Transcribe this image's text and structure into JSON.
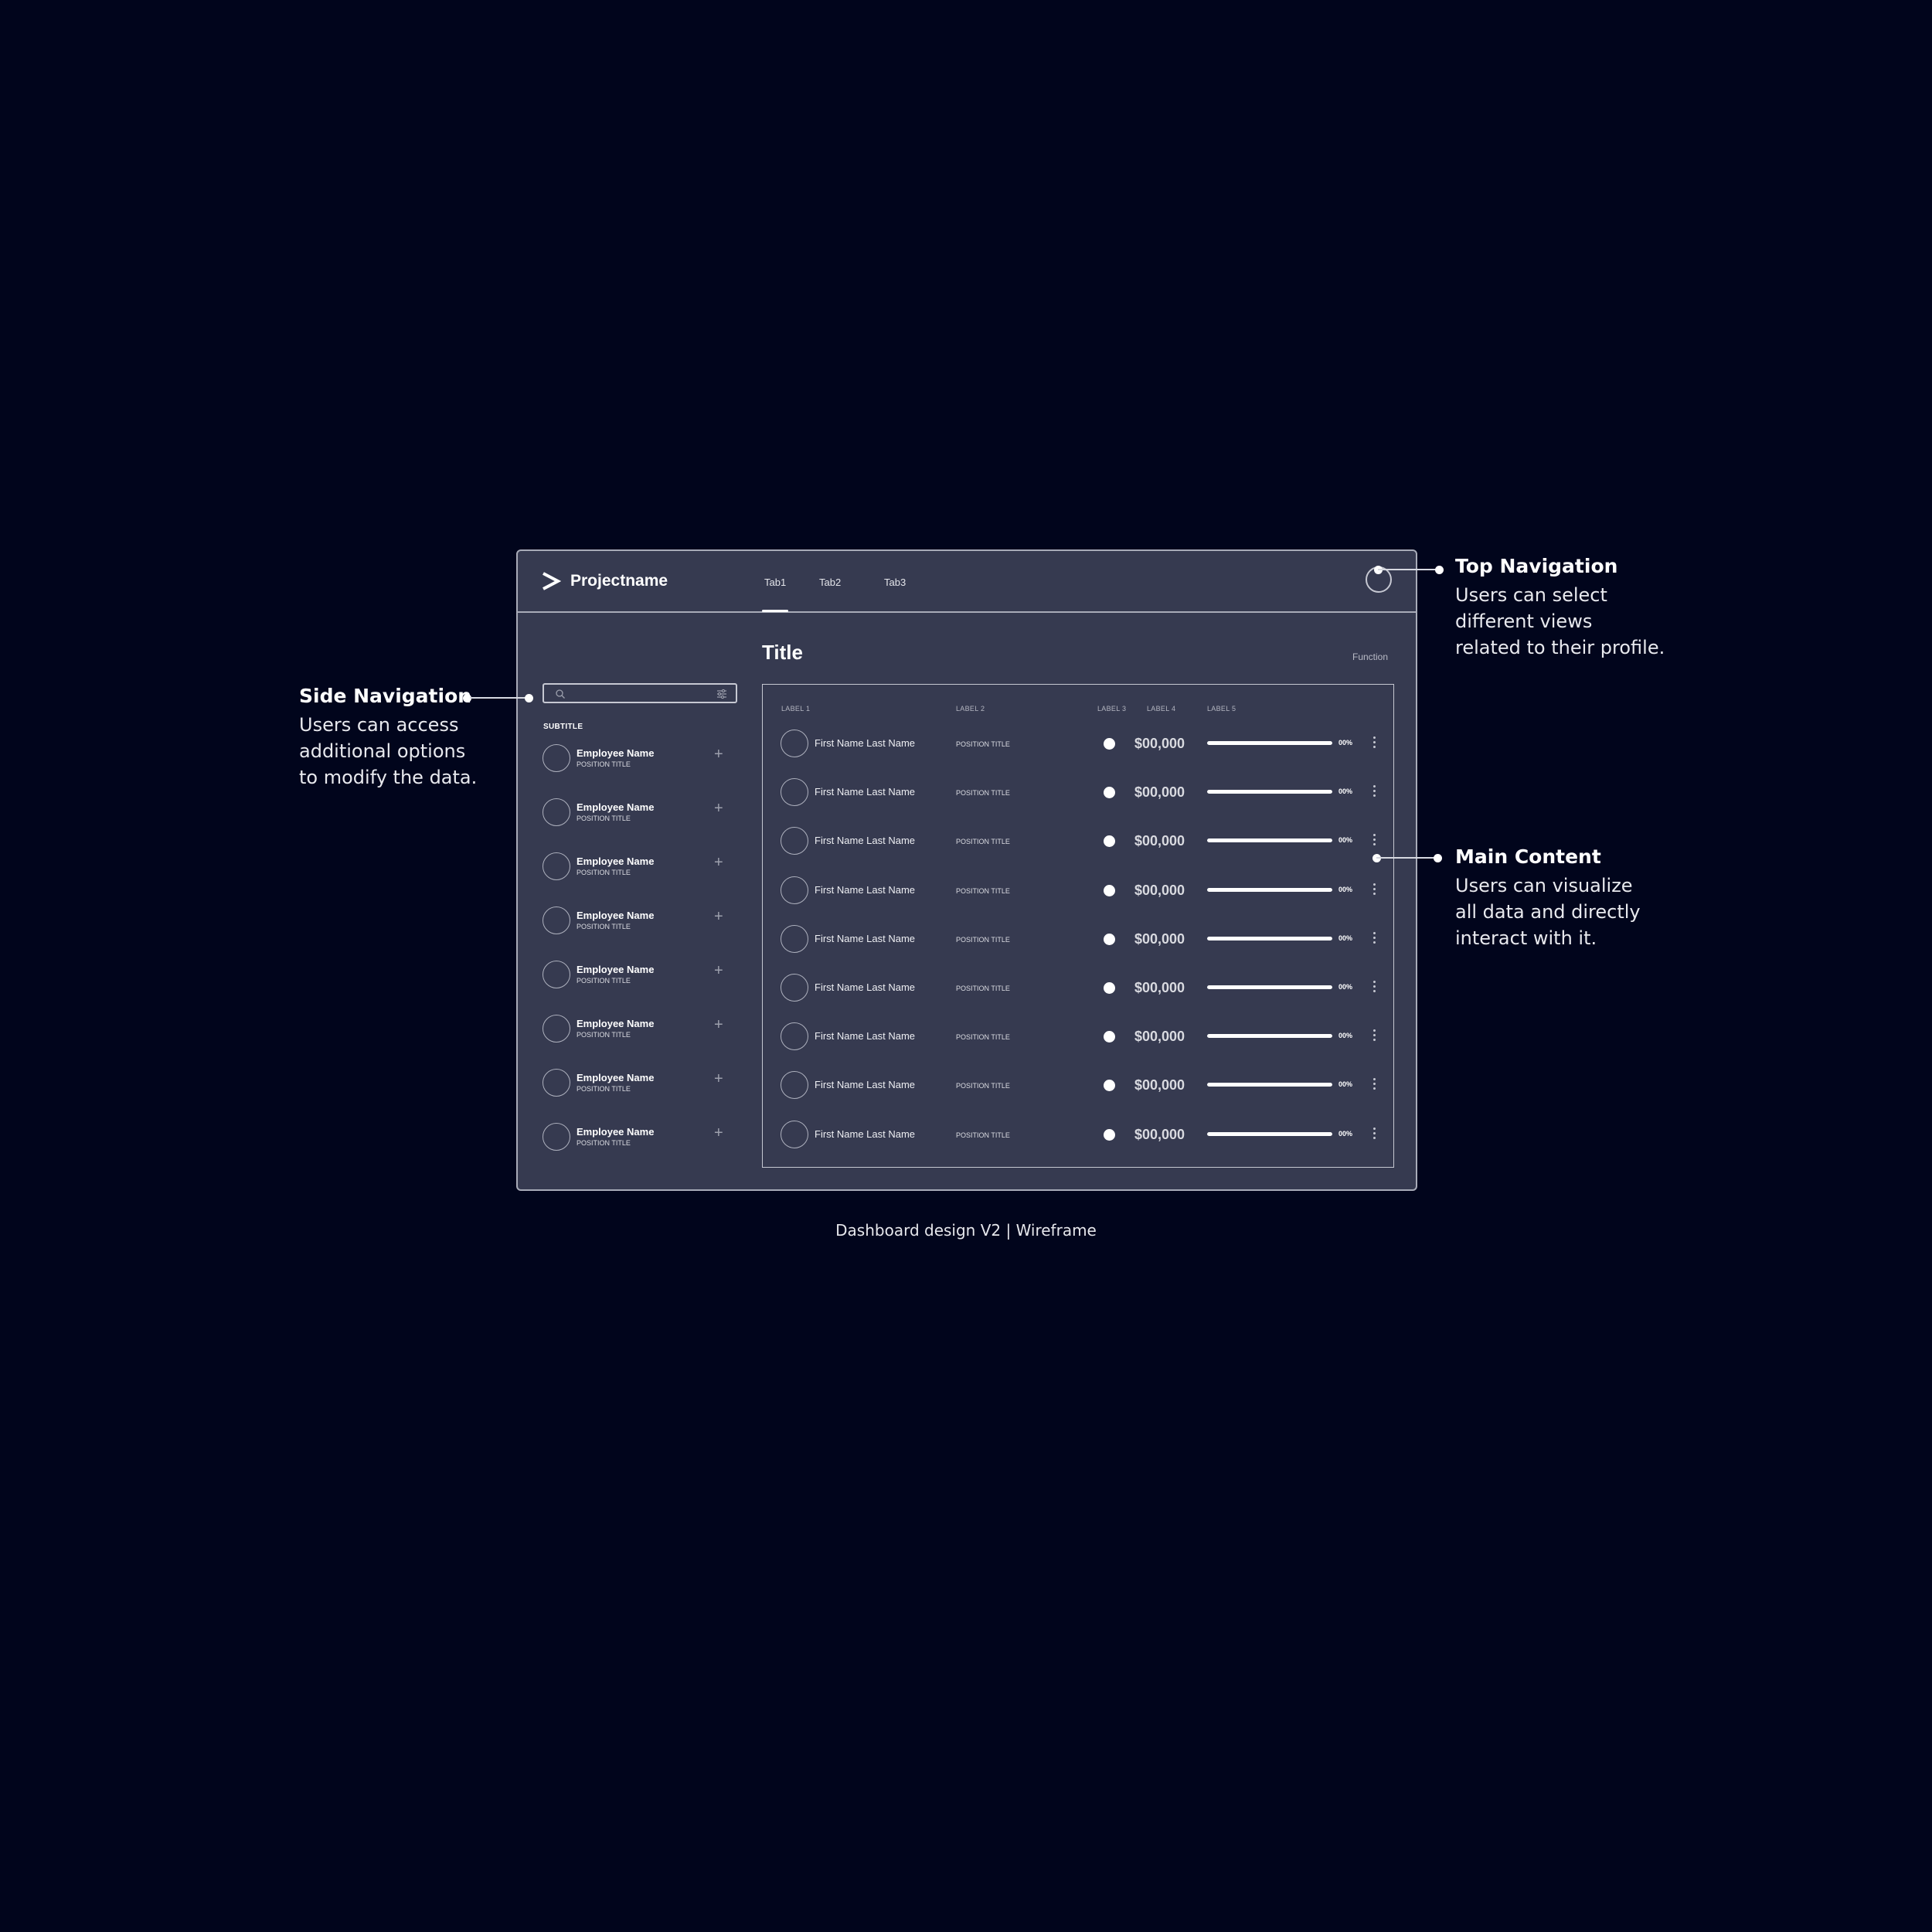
{
  "app": {
    "brand": "Projectname"
  },
  "tabs": [
    {
      "label": "Tab1"
    },
    {
      "label": "Tab2"
    },
    {
      "label": "Tab3"
    }
  ],
  "sidebar": {
    "subtitle": "SUBTITLE",
    "employees": [
      {
        "name": "Employee Name",
        "position": "POSITION TITLE"
      },
      {
        "name": "Employee Name",
        "position": "POSITION TITLE"
      },
      {
        "name": "Employee Name",
        "position": "POSITION TITLE"
      },
      {
        "name": "Employee Name",
        "position": "POSITION TITLE"
      },
      {
        "name": "Employee Name",
        "position": "POSITION TITLE"
      },
      {
        "name": "Employee Name",
        "position": "POSITION TITLE"
      },
      {
        "name": "Employee Name",
        "position": "POSITION TITLE"
      },
      {
        "name": "Employee Name",
        "position": "POSITION TITLE"
      }
    ]
  },
  "main": {
    "title": "Title",
    "function_label": "Function",
    "columns": [
      "LABEL 1",
      "LABEL 2",
      "LABEL 3",
      "LABEL 4",
      "LABEL 5"
    ],
    "rows": [
      {
        "name": "First Name Last Name",
        "position": "POSITION TITLE",
        "amount": "$00,000",
        "progress": 1.0,
        "percent": "00%"
      },
      {
        "name": "First Name Last Name",
        "position": "POSITION TITLE",
        "amount": "$00,000",
        "progress": 1.0,
        "percent": "00%"
      },
      {
        "name": "First Name Last Name",
        "position": "POSITION TITLE",
        "amount": "$00,000",
        "progress": 1.0,
        "percent": "00%"
      },
      {
        "name": "First Name Last Name",
        "position": "POSITION TITLE",
        "amount": "$00,000",
        "progress": 1.0,
        "percent": "00%"
      },
      {
        "name": "First Name Last Name",
        "position": "POSITION TITLE",
        "amount": "$00,000",
        "progress": 1.0,
        "percent": "00%"
      },
      {
        "name": "First Name Last Name",
        "position": "POSITION TITLE",
        "amount": "$00,000",
        "progress": 1.0,
        "percent": "00%"
      },
      {
        "name": "First Name Last Name",
        "position": "POSITION TITLE",
        "amount": "$00,000",
        "progress": 1.0,
        "percent": "00%"
      },
      {
        "name": "First Name Last Name",
        "position": "POSITION TITLE",
        "amount": "$00,000",
        "progress": 1.0,
        "percent": "00%"
      },
      {
        "name": "First Name Last Name",
        "position": "POSITION TITLE",
        "amount": "$00,000",
        "progress": 1.0,
        "percent": "00%"
      }
    ]
  },
  "callouts": {
    "top": {
      "title": "Top Navigation",
      "lines": [
        "Users can select",
        "different views",
        "related to their profile."
      ]
    },
    "side": {
      "title": "Side Navigation",
      "lines": [
        "Users can access",
        "additional options",
        "to modify the data."
      ]
    },
    "main": {
      "title": "Main Content",
      "lines": [
        "Users can visualize",
        "all data and directly",
        "interact with it."
      ]
    }
  },
  "caption": "Dashboard design V2 | Wireframe",
  "colors": {
    "background": "#01051c",
    "panel": "#363a50",
    "border": "#a8abb8",
    "accent": "#ffffff"
  },
  "icons": {
    "logo": "chevron-right-icon",
    "search": "search-icon",
    "filter": "sliders-icon",
    "add": "plus-icon",
    "more": "more-vertical-icon",
    "profile": "avatar-circle"
  }
}
